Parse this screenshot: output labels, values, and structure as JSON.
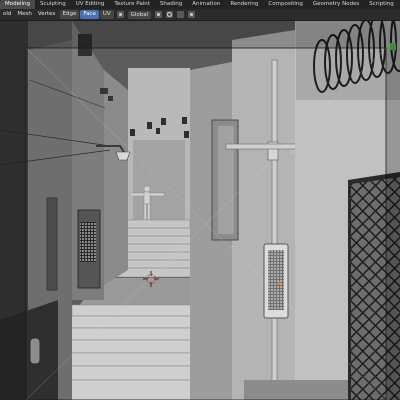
{
  "workspace_tabs": [
    "Modeling",
    "Sculpting",
    "UV Editing",
    "Texture Paint",
    "Shading",
    "Animation",
    "Rendering",
    "Compositing",
    "Geometry Nodes",
    "Scripting"
  ],
  "active_tab": "Modeling",
  "header": {
    "menus": [
      "old",
      "Mesh",
      "Vertex",
      "Edge",
      "Face",
      "UV"
    ],
    "selected_menu": "Face",
    "transform_orientation": "Global"
  },
  "colors": {
    "accent": "#4772b3",
    "tabbar_bg": "#232323",
    "header_bg": "#2b2b2b",
    "viewport_bg": "#5a5a5a"
  },
  "icons": {
    "orientation": "orientation-icon",
    "pivot": "pivot-icon",
    "snap": "snap-magnet-icon",
    "proportional": "proportional-edit-icon",
    "origin_marker": "3d-cursor-icon"
  }
}
